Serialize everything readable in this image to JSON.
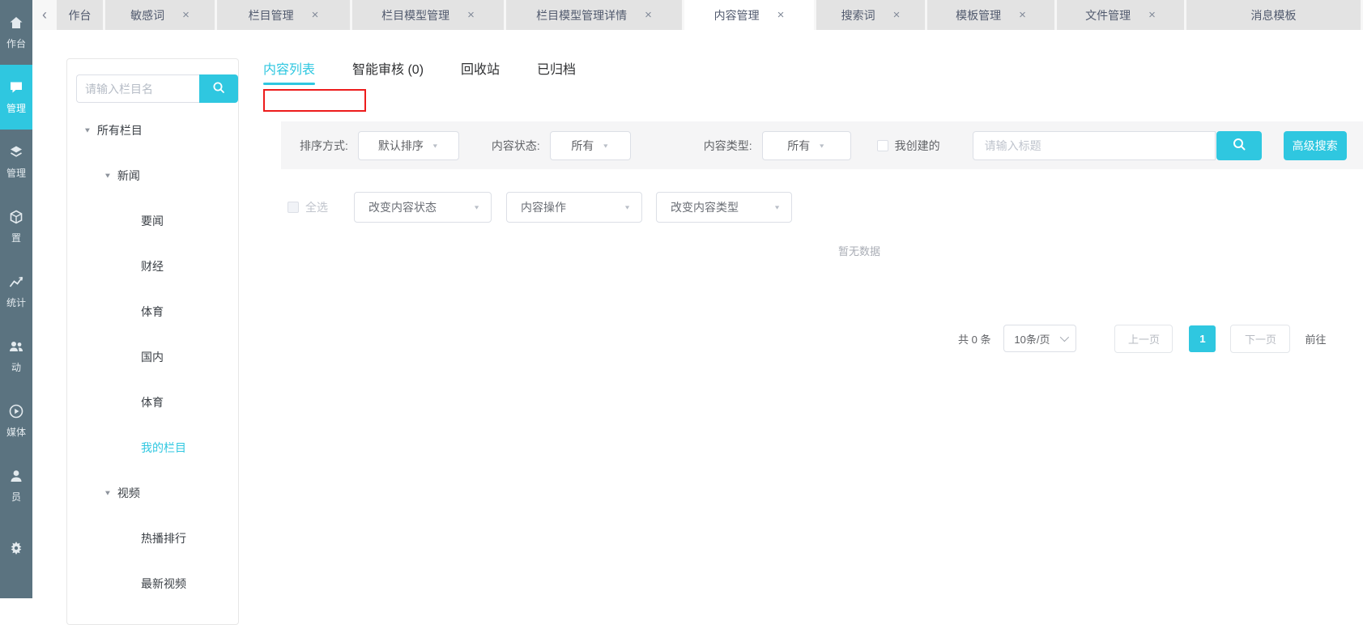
{
  "accent_color": "#2fc7e0",
  "sidebar_color": "#5b7380",
  "glyphs": {
    "close": "×",
    "back_chevron": "‹",
    "caret_down": "▼"
  },
  "sidebar": {
    "items": [
      {
        "icon": "home-icon",
        "label": "作台",
        "active": false
      },
      {
        "icon": "content-icon",
        "label": "管理",
        "active": true
      },
      {
        "icon": "layers-icon",
        "label": "管理",
        "active": false
      },
      {
        "icon": "cube-icon",
        "label": "置",
        "active": false
      },
      {
        "icon": "chart-icon",
        "label": "统计",
        "active": false
      },
      {
        "icon": "people-icon",
        "label": "动",
        "active": false
      },
      {
        "icon": "media-icon",
        "label": "媒体",
        "active": false
      },
      {
        "icon": "member-icon",
        "label": "员",
        "active": false
      },
      {
        "icon": "gear-icon",
        "label": "",
        "active": false
      }
    ]
  },
  "tab_bar": {
    "tabs": [
      {
        "label": "作台",
        "closable": false,
        "active": false
      },
      {
        "label": "敏感词",
        "closable": true,
        "active": false
      },
      {
        "label": "栏目管理",
        "closable": true,
        "active": false
      },
      {
        "label": "栏目模型管理",
        "closable": true,
        "active": false
      },
      {
        "label": "栏目模型管理详情",
        "closable": true,
        "active": false
      },
      {
        "label": "内容管理",
        "closable": true,
        "active": true
      },
      {
        "label": "搜索词",
        "closable": true,
        "active": false
      },
      {
        "label": "模板管理",
        "closable": true,
        "active": false
      },
      {
        "label": "文件管理",
        "closable": true,
        "active": false
      },
      {
        "label": "消息模板",
        "closable": false,
        "active": false
      }
    ]
  },
  "tree_panel": {
    "search_placeholder": "请输入栏目名",
    "nodes": [
      {
        "label": "所有栏目",
        "level": 0,
        "expanded": true,
        "selected": false
      },
      {
        "label": "新闻",
        "level": 1,
        "expanded": true,
        "selected": false
      },
      {
        "label": "要闻",
        "level": 2,
        "expanded": false,
        "selected": false
      },
      {
        "label": "财经",
        "level": 2,
        "expanded": false,
        "selected": false
      },
      {
        "label": "体育",
        "level": 2,
        "expanded": false,
        "selected": false
      },
      {
        "label": "国内",
        "level": 2,
        "expanded": false,
        "selected": false
      },
      {
        "label": "体育",
        "level": 2,
        "expanded": false,
        "selected": false
      },
      {
        "label": "我的栏目",
        "level": 2,
        "expanded": false,
        "selected": true
      },
      {
        "label": "视频",
        "level": 1,
        "expanded": true,
        "selected": false
      },
      {
        "label": "热播排行",
        "level": 2,
        "expanded": false,
        "selected": false
      },
      {
        "label": "最新视频",
        "level": 2,
        "expanded": false,
        "selected": false
      }
    ]
  },
  "content": {
    "tabs": [
      {
        "label": "内容列表",
        "active": true
      },
      {
        "label": "智能审核 (0)",
        "active": false
      },
      {
        "label": "回收站",
        "active": false
      },
      {
        "label": "已归档",
        "active": false
      }
    ],
    "filters": {
      "sort_label": "排序方式:",
      "sort_value": "默认排序",
      "status_label": "内容状态:",
      "status_value": "所有",
      "type_label": "内容类型:",
      "type_value": "所有",
      "mine_label": "我创建的",
      "title_placeholder": "请输入标题",
      "advanced_label": "高级搜索"
    },
    "batch": {
      "select_all_label": "全选",
      "action_selects": [
        "改变内容状态",
        "内容操作",
        "改变内容类型"
      ]
    },
    "empty_text": "暂无数据",
    "pagination": {
      "total": "共 0 条",
      "page_size": "10条/页",
      "prev_label": "上一页",
      "current_page": "1",
      "next_label": "下一页",
      "goto_label": "前往"
    }
  }
}
